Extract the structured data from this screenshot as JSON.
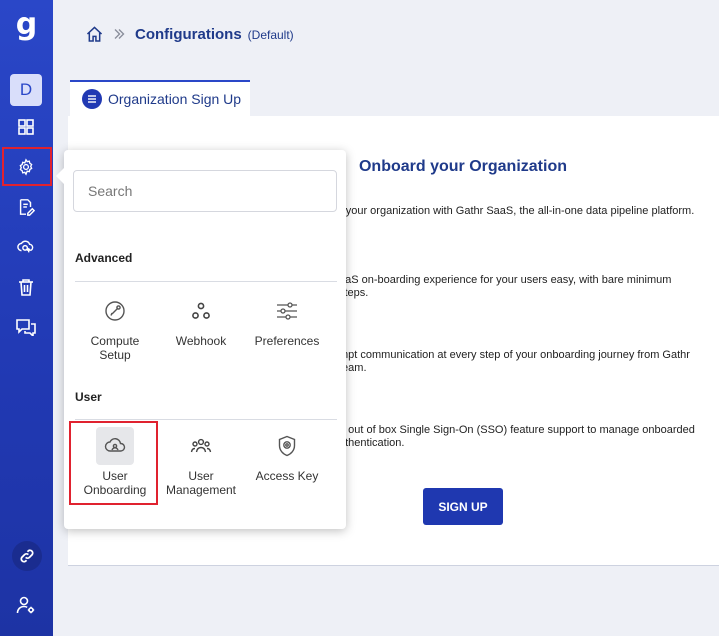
{
  "sidebar": {
    "logo": "g",
    "avatar_letter": "D",
    "items": [
      {
        "icon": "dashboard-grid-icon"
      },
      {
        "icon": "gear-icon"
      },
      {
        "icon": "document-edit-icon"
      },
      {
        "icon": "cloud-sync-icon"
      },
      {
        "icon": "trash-icon"
      },
      {
        "icon": "chat-icon"
      },
      {
        "icon": "link-icon"
      },
      {
        "icon": "user-settings-icon"
      }
    ]
  },
  "breadcrumb": {
    "title": "Configurations",
    "subtitle": "(Default)"
  },
  "tab": {
    "label": "Organization Sign Up"
  },
  "card": {
    "title": "Onboard your Organization",
    "paragraphs": [
      [
        "r your organization with Gathr SaaS, the all-in-one data pipeline platform."
      ],
      [
        "aaS on-boarding experience for your users easy, with bare minimum",
        "steps."
      ],
      [
        "mpt communication at every step of your onboarding journey from Gathr",
        "team."
      ],
      [
        "e out of box Single Sign-On (SSO) feature support to manage onboarded",
        "uthentication."
      ]
    ],
    "signup_label": "SIGN UP"
  },
  "popup": {
    "search_placeholder": "Search",
    "sections": [
      {
        "label": "Advanced",
        "options": [
          {
            "label": "Compute\nSetup",
            "icon": "compute-setup-icon"
          },
          {
            "label": "Webhook",
            "icon": "webhook-icon"
          },
          {
            "label": "Preferences",
            "icon": "sliders-icon"
          }
        ]
      },
      {
        "label": "User",
        "options": [
          {
            "label": "User\nOnboarding",
            "icon": "cloud-user-icon"
          },
          {
            "label": "User\nManagement",
            "icon": "users-group-icon"
          },
          {
            "label": "Access Key",
            "icon": "shield-key-icon"
          }
        ]
      }
    ]
  },
  "colors": {
    "sidebar": "#2139b3",
    "accent": "#1f3a8a",
    "highlight": "#e0222f",
    "button": "#1f38b0"
  }
}
